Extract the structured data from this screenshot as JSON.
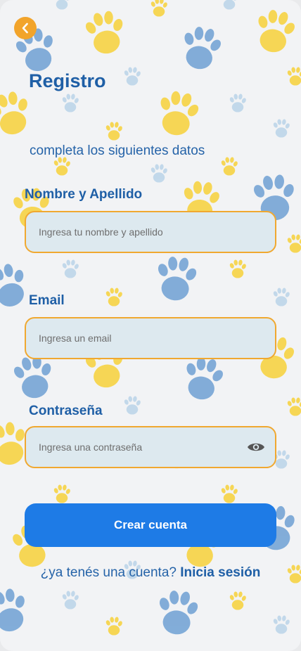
{
  "header": {
    "back_icon": "chevron-left-icon",
    "title": "Registro",
    "subtitle": "completa los siguientes datos"
  },
  "form": {
    "name": {
      "label": "Nombre y Apellido",
      "placeholder": "Ingresa tu nombre y apellido",
      "value": ""
    },
    "email": {
      "label": "Email",
      "placeholder": "Ingresa un email",
      "value": ""
    },
    "password": {
      "label": "Contraseña",
      "placeholder": "Ingresa una contraseña",
      "value": "",
      "toggle_icon": "eye-icon"
    },
    "submit_label": "Crear cuenta"
  },
  "footer": {
    "question": "¿ya tenés una cuenta?",
    "link": "Inicia sesión"
  },
  "colors": {
    "title": "#1f5fa6",
    "accent_orange": "#f2a42b",
    "field_border": "#f0a830",
    "field_bg": "#dde9ef",
    "primary_button": "#1e7be6",
    "paw_blue": "#5f97cf",
    "paw_yellow": "#f7d344",
    "background": "#f2f3f5"
  }
}
